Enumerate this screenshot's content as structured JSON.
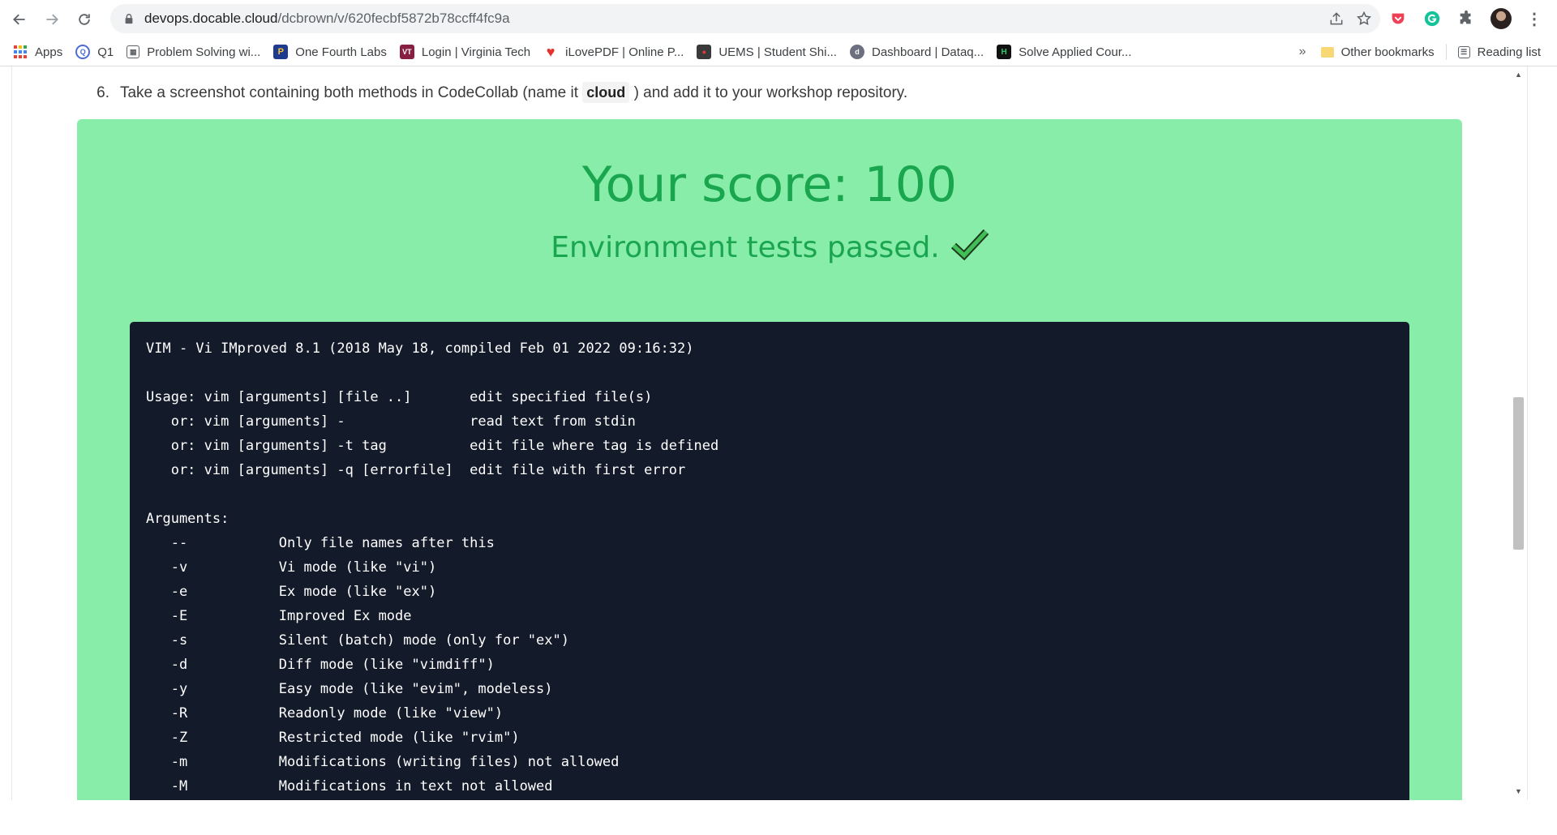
{
  "browser": {
    "url_host": "devops.docable.cloud",
    "url_path": "/dcbrown/v/620fecbf5872b78ccff4fc9a",
    "bookmarks": [
      {
        "label": "Apps",
        "icon": "apps-grid-icon",
        "color": "#ea4335"
      },
      {
        "label": "Q1",
        "icon": "q1-icon",
        "color": "#4f6bd8"
      },
      {
        "label": "Problem Solving wi...",
        "icon": "page-icon",
        "color": "#5f6368"
      },
      {
        "label": "One Fourth Labs",
        "icon": "p-logo-icon",
        "color": "#1f3b8f"
      },
      {
        "label": "Login | Virginia Tech",
        "icon": "vt-logo-icon",
        "color": "#861f41"
      },
      {
        "label": "iLovePDF | Online P...",
        "icon": "heart-icon",
        "color": "#e5322d"
      },
      {
        "label": "UEMS | Student Shi...",
        "icon": "uems-icon",
        "color": "#3a3a3a"
      },
      {
        "label": "Dashboard | Dataq...",
        "icon": "dataq-icon",
        "color": "#6b6f80"
      },
      {
        "label": "Solve Applied Cour...",
        "icon": "hackerrank-icon",
        "color": "#111111"
      }
    ],
    "more_label": "»",
    "other_bookmarks": "Other bookmarks",
    "reading_list": "Reading list"
  },
  "page": {
    "step_number": "6.",
    "step_text_before": "Take a screenshot containing both methods in CodeCollab (name it",
    "step_code": "cloud",
    "step_text_after": ") and add it to your workshop repository.",
    "score_text": "Your score: 100",
    "passed_text": "Environment tests passed.",
    "terminal_output": "VIM - Vi IMproved 8.1 (2018 May 18, compiled Feb 01 2022 09:16:32)\n\nUsage: vim [arguments] [file ..]       edit specified file(s)\n   or: vim [arguments] -               read text from stdin\n   or: vim [arguments] -t tag          edit file where tag is defined\n   or: vim [arguments] -q [errorfile]  edit file with first error\n\nArguments:\n   --           Only file names after this\n   -v           Vi mode (like \"vi\")\n   -e           Ex mode (like \"ex\")\n   -E           Improved Ex mode\n   -s           Silent (batch) mode (only for \"ex\")\n   -d           Diff mode (like \"vimdiff\")\n   -y           Easy mode (like \"evim\", modeless)\n   -R           Readonly mode (like \"view\")\n   -Z           Restricted mode (like \"rvim\")\n   -m           Modifications (writing files) not allowed\n   -M           Modifications in text not allowed"
  },
  "colors": {
    "success_bg": "#88eda9",
    "success_text": "#1aa64f",
    "terminal_bg": "#131a2a"
  }
}
